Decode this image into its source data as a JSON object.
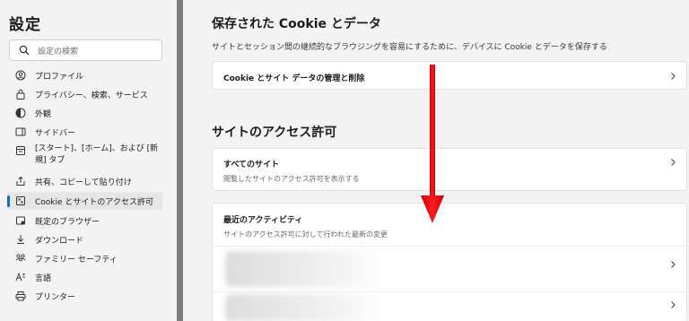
{
  "sidebar": {
    "title": "設定",
    "search_placeholder": "設定の検索",
    "items": [
      {
        "label": "プロファイル",
        "icon": "profile-icon"
      },
      {
        "label": "プライバシー、検索、サービス",
        "icon": "lock-icon"
      },
      {
        "label": "外観",
        "icon": "appearance-icon"
      },
      {
        "label": "サイドバー",
        "icon": "sidebar-icon"
      },
      {
        "label": "[スタート]、[ホーム]、および [新規] タブ",
        "icon": "home-tab-icon"
      },
      {
        "label": "共有、コピーして貼り付け",
        "icon": "share-icon"
      },
      {
        "label": "Cookie とサイトのアクセス許可",
        "icon": "cookie-permissions-icon",
        "active": true
      },
      {
        "label": "既定のブラウザー",
        "icon": "default-browser-icon"
      },
      {
        "label": "ダウンロード",
        "icon": "download-icon"
      },
      {
        "label": "ファミリー セーフティ",
        "icon": "family-icon"
      },
      {
        "label": "言語",
        "icon": "language-icon"
      },
      {
        "label": "プリンター",
        "icon": "printer-icon"
      }
    ]
  },
  "main": {
    "cookies_section": {
      "title": "保存された Cookie とデータ",
      "description": "サイトとセッション間の継続的なブラウジングを容易にするために、デバイスに Cookie とデータを保存する",
      "manage_item": "Cookie とサイト データの管理と削除"
    },
    "permissions_section": {
      "title": "サイトのアクセス許可",
      "all_sites_title": "すべてのサイト",
      "all_sites_sub": "閲覧したサイトのアクセス許可を表示する",
      "recent_title": "最近のアクティビティ",
      "recent_sub": "サイトのアクセス許可に対して行われた最新の変更"
    }
  },
  "colors": {
    "accent": "#0f6cbd",
    "annotation_arrow": "#e8101a",
    "divider": "#7d7d7d"
  }
}
